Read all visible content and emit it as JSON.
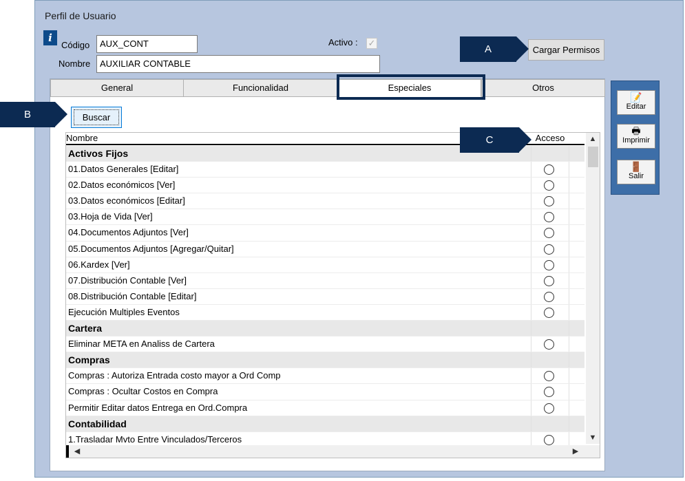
{
  "window": {
    "title": "Perfil de Usuario"
  },
  "form": {
    "codigo_label": "Código",
    "codigo_value": "AUX_CONT",
    "nombre_label": "Nombre",
    "nombre_value": "AUXILIAR CONTABLE",
    "activo_label": "Activo :",
    "activo_checked": true,
    "cargar_permisos_label": "Cargar Permisos"
  },
  "tabs": [
    {
      "label": "General"
    },
    {
      "label": "Funcionalidad"
    },
    {
      "label": "Especiales",
      "active": true
    },
    {
      "label": "Otros"
    }
  ],
  "buscar_label": "Buscar",
  "grid": {
    "columns": {
      "nombre": "Nombre",
      "acceso": "Acceso"
    },
    "rows": [
      {
        "text": "Activos Fijos",
        "group": true
      },
      {
        "text": "01.Datos Generales [Editar]"
      },
      {
        "text": "02.Datos económicos [Ver]"
      },
      {
        "text": "03.Datos económicos [Editar]"
      },
      {
        "text": "03.Hoja de Vida [Ver]"
      },
      {
        "text": "04.Documentos Adjuntos [Ver]"
      },
      {
        "text": "05.Documentos Adjuntos [Agregar/Quitar]"
      },
      {
        "text": "06.Kardex [Ver]"
      },
      {
        "text": "07.Distribución Contable [Ver]"
      },
      {
        "text": "08.Distribución Contable [Editar]"
      },
      {
        "text": "Ejecución Multiples Eventos"
      },
      {
        "text": "Cartera",
        "group": true
      },
      {
        "text": "Eliminar META en Analiss de Cartera"
      },
      {
        "text": "Compras",
        "group": true
      },
      {
        "text": "Compras : Autoriza Entrada costo mayor a Ord Comp"
      },
      {
        "text": "Compras : Ocultar Costos en Compra"
      },
      {
        "text": "Permitir Editar datos Entrega en Ord.Compra"
      },
      {
        "text": "Contabilidad",
        "group": true
      },
      {
        "text": "1.Trasladar Mvto Entre Vinculados/Terceros"
      }
    ]
  },
  "toolbar": {
    "editar": "Editar",
    "imprimir": "Imprimir",
    "salir": "Salir"
  },
  "callouts": {
    "a": "A",
    "b": "B",
    "c": "C"
  },
  "colors": {
    "window_bg": "#b7c6df",
    "toolbar_bg": "#3d6ea8",
    "callout_bg": "#0c2a52"
  }
}
